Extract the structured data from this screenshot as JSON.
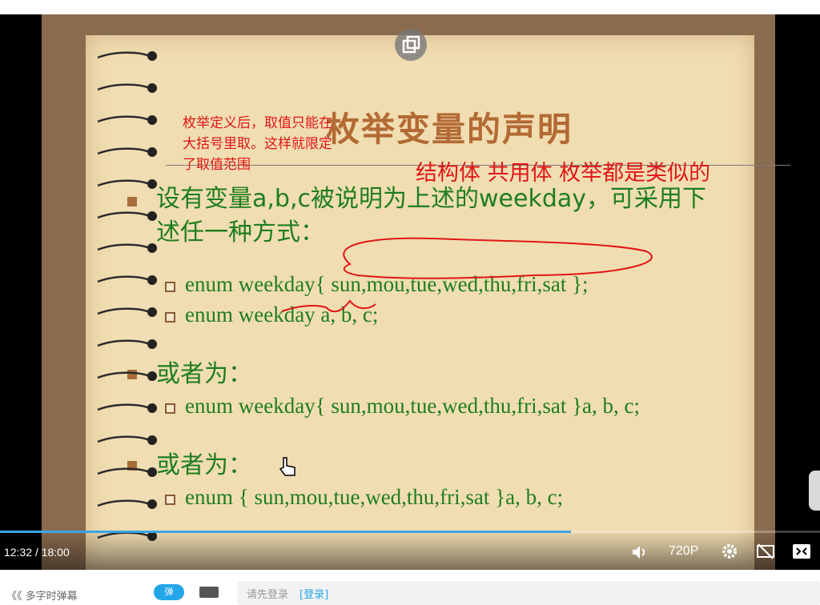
{
  "slide": {
    "title": "枚举变量的声明",
    "red_note_left": "枚举定义后，取值只能在大括号里取。这样就限定了取值范围",
    "red_note_right": "结构体 共用体 枚举都是类似的",
    "bullet1_text": "设有变量a,b,c被说明为上述的weekday，可采用下述任一种方式：",
    "code1": "enum weekday{ sun,mou,tue,wed,thu,fri,sat };",
    "code2": "enum weekday a, b, c;",
    "bullet2_text": "或者为：",
    "code3": "enum weekday{ sun,mou,tue,wed,thu,fri,sat }a, b, c;",
    "bullet3_text": "或者为：",
    "code4": "enum { sun,mou,tue,wed,thu,fri,sat }a, b, c;"
  },
  "player": {
    "time_current": "12:32",
    "time_separator": "/",
    "time_total": "18:00",
    "quality": "720P",
    "progress_fraction": 0.696,
    "accent_color": "#3aa5e8",
    "icons": [
      "popout-icon",
      "volume-icon",
      "settings-icon",
      "danmaku-off-icon",
      "fullscreen-icon",
      "cursor-hand-icon"
    ]
  },
  "footer": {
    "left_label": "《《 多字时弹幕",
    "toggle_label": "弹",
    "input_placeholder": "请先登录 ",
    "login_link": "[登录]"
  }
}
